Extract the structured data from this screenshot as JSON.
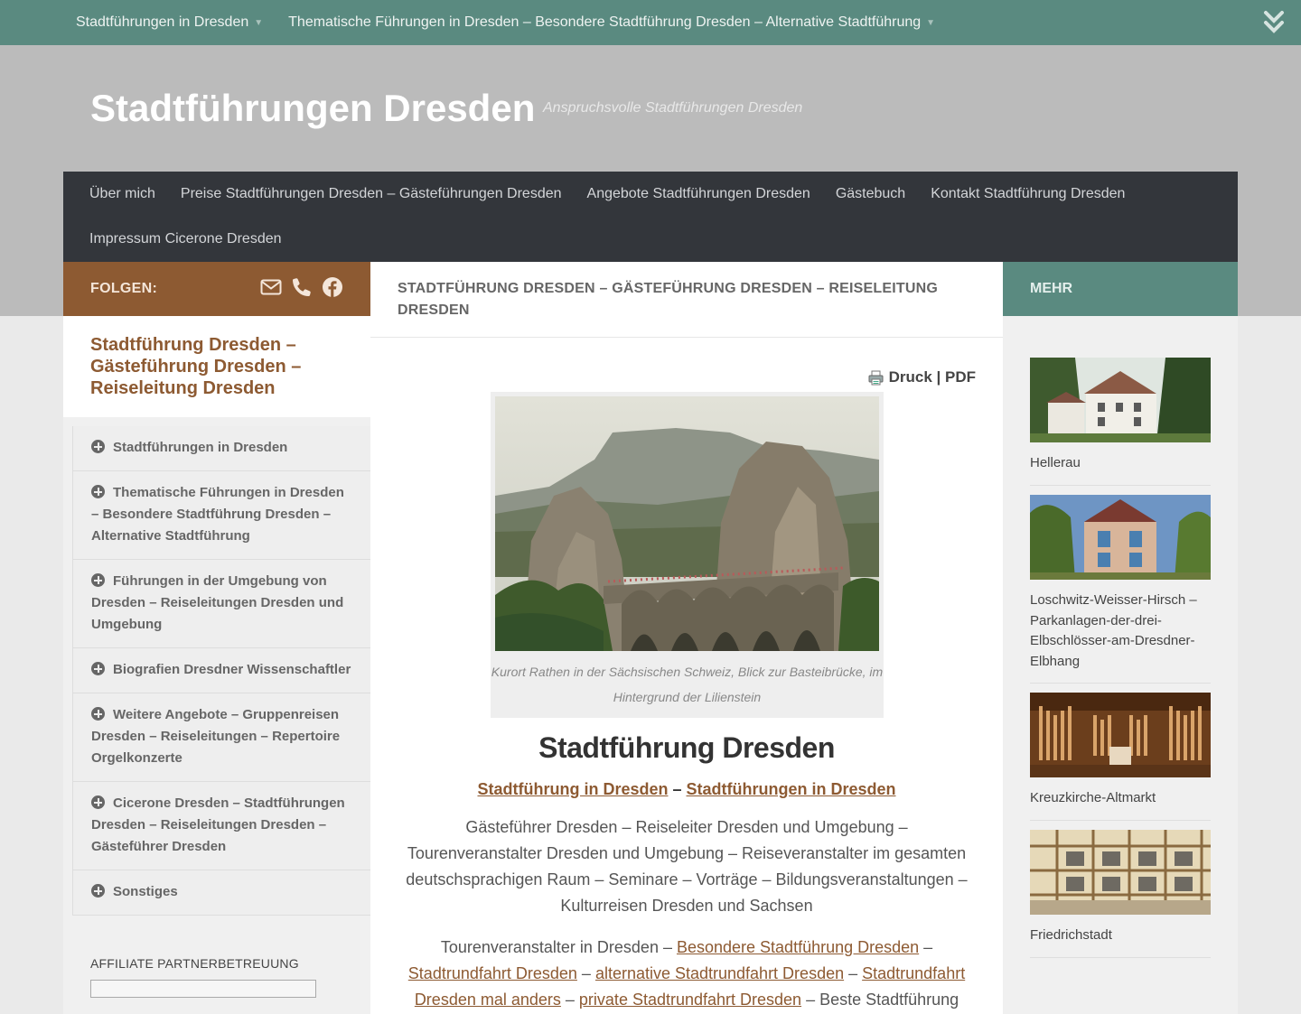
{
  "topbar": {
    "items": [
      {
        "label": "Stadtführungen in Dresden"
      },
      {
        "label": "Thematische Führungen in Dresden – Besondere Stadtführung Dresden – Alternative Stadtführung"
      }
    ],
    "chevron_icon": "double-chevron-down-icon"
  },
  "header": {
    "title": "Stadtführungen Dresden",
    "tagline": "Anspruchsvolle Stadtführungen Dresden"
  },
  "mainnav": {
    "row1": [
      "Über mich",
      "Preise Stadtführungen Dresden – Gästeführungen Dresden",
      "Angebote Stadtführungen Dresden",
      "Gästebuch",
      "Kontakt Stadtführung Dresden"
    ],
    "row2": [
      "Impressum Cicerone Dresden"
    ]
  },
  "left": {
    "follow_label": "FOLGEN:",
    "icons": [
      "envelope-icon",
      "phone-icon",
      "facebook-icon"
    ],
    "widget_title": "Stadtführung Dresden – Gästeführung Dresden – Reiseleitung Dresden",
    "categories": [
      "Stadtführungen in Dresden",
      "Thematische Führungen in Dresden – Besondere Stadtführung Dresden – Alternative Stadtführung",
      "Führungen in der Umgebung von Dresden – Reiseleitungen Dresden und Umgebung",
      "Biografien Dresdner Wissenschaftler",
      "Weitere Angebote – Gruppenreisen Dresden – Reiseleitungen – Repertoire Orgelkonzerte",
      "Cicerone Dresden – Stadtführungen Dresden – Reiseleitungen Dresden – Gästeführer Dresden",
      "Sonstiges"
    ],
    "affiliate_label": "AFFILIATE PARTNERBETREUUNG"
  },
  "content": {
    "page_title": "STADTFÜHRUNG DRESDEN – GÄSTEFÜHRUNG DRESDEN – REISELEITUNG DRESDEN",
    "print_label": "Druck | PDF",
    "caption": "Kurort Rathen in der Sächsischen Schweiz, Blick zur Basteibrücke, im Hintergrund der Lilienstein",
    "heading": "Stadtführung Dresden",
    "sublinks": {
      "link1": "Stadtführung in Dresden",
      "sep": " – ",
      "link2": "Stadtführungen in Dresden"
    },
    "para1": "Gästeführer Dresden – Reiseleiter Dresden und Umgebung – Tourenveranstalter Dresden und Umgebung – Reiseveranstalter im gesamten deutschsprachigen Raum – Seminare – Vorträge – Bildungsveranstaltungen – Kulturreisen Dresden und Sachsen",
    "para2": {
      "t1": "Tourenveranstalter in Dresden – ",
      "l1": "Besondere Stadtführung Dresden",
      "t2": " – ",
      "l2": "Stadtrundfahrt Dresden",
      "t3": " – ",
      "l3": "alternative Stadtrundfahrt Dresden",
      "t4": " – ",
      "l4": "Stadtrundfahrt Dresden mal anders",
      "t5": " – ",
      "l5": "private Stadtrundfahrt Dresden",
      "t6": " – Beste Stadtführung"
    }
  },
  "right": {
    "more_label": "MEHR",
    "posts": [
      {
        "caption": "Hellerau"
      },
      {
        "caption": "Loschwitz-Weisser-Hirsch – Parkanlagen-der-drei-Elbschlösser-am-Dresdner-Elbhang"
      },
      {
        "caption": "Kreuzkirche-Altmarkt"
      },
      {
        "caption": "Friedrichstadt"
      }
    ]
  },
  "colors": {
    "accent_brown": "#8d5a32",
    "accent_teal": "#5a8a80",
    "nav_dark": "#33363b"
  }
}
